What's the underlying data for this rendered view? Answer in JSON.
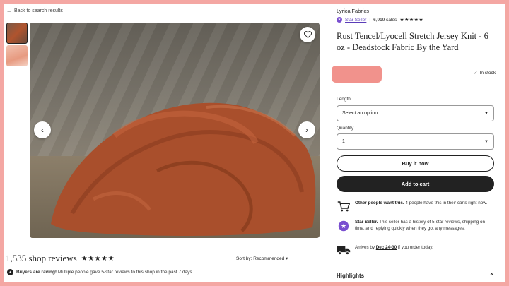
{
  "nav": {
    "back_label": "Back to search results"
  },
  "gallery": {
    "thumbnail_count": 2
  },
  "reviews": {
    "count_label": "1,535 shop reviews",
    "rating_stars": "★★★★★",
    "sort_label": "Sort by: Recommended",
    "raving_bold": "Buyers are raving!",
    "raving_text": "Multiple people gave 5-star reviews to this shop in the past 7 days."
  },
  "shop": {
    "name": "LyricalFabrics",
    "badge": "Star Seller",
    "sales": "6,919 sales",
    "rating_stars": "★★★★★"
  },
  "product": {
    "title": "Rust Tencel/Lyocell Stretch Jersey Knit - 6 oz - Deadstock Fabric By the Yard",
    "stock": "In stock"
  },
  "options": {
    "length_label": "Length",
    "length_value": "Select an option",
    "quantity_label": "Quantity",
    "quantity_value": "1"
  },
  "actions": {
    "buy_now": "Buy it now",
    "add_to_cart": "Add to cart"
  },
  "info": {
    "demand_bold": "Other people want this.",
    "demand_text": "4 people have this in their carts right now.",
    "star_bold": "Star Seller.",
    "star_text": "This seller has a history of 5-star reviews, shipping on time, and replying quickly when they got any messages.",
    "arrives_prefix": "Arrives by",
    "arrives_date": "Dec 24-30",
    "arrives_suffix": "if you order today."
  },
  "highlights": {
    "label": "Highlights"
  },
  "colors": {
    "background": "#f4a7a3",
    "star_seller": "#5a3db8",
    "price_block": "#f08c86",
    "fabric": "#b0542e"
  }
}
